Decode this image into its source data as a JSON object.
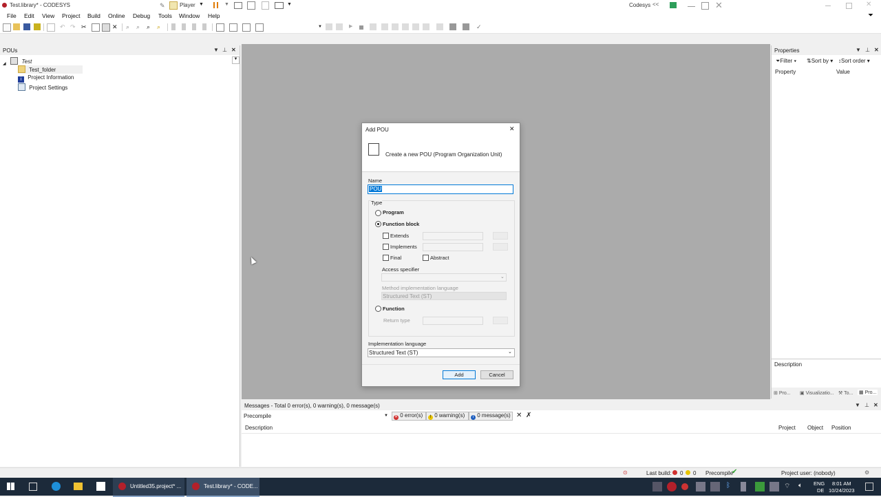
{
  "window": {
    "title": "Test.library* - CODESYS",
    "player_label": "Player",
    "user_label": "Codesys"
  },
  "menu": [
    "File",
    "Edit",
    "View",
    "Project",
    "Build",
    "Online",
    "Debug",
    "Tools",
    "Window",
    "Help"
  ],
  "pous_panel": {
    "title": "POUs",
    "tree": {
      "root": "Test",
      "items": [
        "Test_folder",
        "Project Information",
        "Project Settings"
      ]
    }
  },
  "properties_panel": {
    "title": "Properties",
    "filter_label": "Filter",
    "sort_by_label": "Sort by",
    "sort_order_label": "Sort order",
    "col_property": "Property",
    "col_value": "Value",
    "description_label": "Description",
    "bottom_tabs": [
      "Pro...",
      "Visualizatio...",
      "To...",
      "Pro..."
    ]
  },
  "dialog": {
    "title": "Add POU",
    "header_text": "Create a new POU (Program Organization Unit)",
    "name_label": "Name",
    "name_value": "POU",
    "type_label": "Type",
    "program_label": "Program",
    "function_block_label": "Function block",
    "extends_label": "Extends",
    "implements_label": "Implements",
    "final_label": "Final",
    "abstract_label": "Abstract",
    "access_specifier_label": "Access specifier",
    "method_impl_lang_label": "Method implementation language",
    "method_impl_lang_value": "Structured Text (ST)",
    "function_label": "Function",
    "return_type_label": "Return type",
    "impl_lang_label": "Implementation language",
    "impl_lang_value": "Structured Text (ST)",
    "add_button": "Add",
    "cancel_button": "Cancel",
    "selected_type": "Function block"
  },
  "messages_panel": {
    "title": "Messages - Total 0 error(s), 0 warning(s), 0 message(s)",
    "filter_value": "Precompile",
    "errors_label": "0 error(s)",
    "warnings_label": "0 warning(s)",
    "messages_label": "0 message(s)",
    "col_description": "Description",
    "col_project": "Project",
    "col_object": "Object",
    "col_position": "Position"
  },
  "statusbar": {
    "last_build_label": "Last build:",
    "errors_count": "0",
    "warnings_count": "0",
    "precompile_label": "Precompile",
    "project_user": "Project user: (nobody)"
  },
  "taskbar": {
    "apps": [
      "Untitled35.project* ...",
      "Test.library* - CODE..."
    ],
    "lang_top": "ENG",
    "lang_bottom": "DE",
    "time": "8:01 AM",
    "date": "10/24/2023"
  },
  "colors": {
    "accent": "#0078d7",
    "workspace": "#ababab",
    "taskbar": "#1c2a3a",
    "error_red": "#d0302f",
    "warning_yellow": "#e8c400",
    "info_blue": "#1f5fbf",
    "ok_green": "#2e9e2e"
  }
}
